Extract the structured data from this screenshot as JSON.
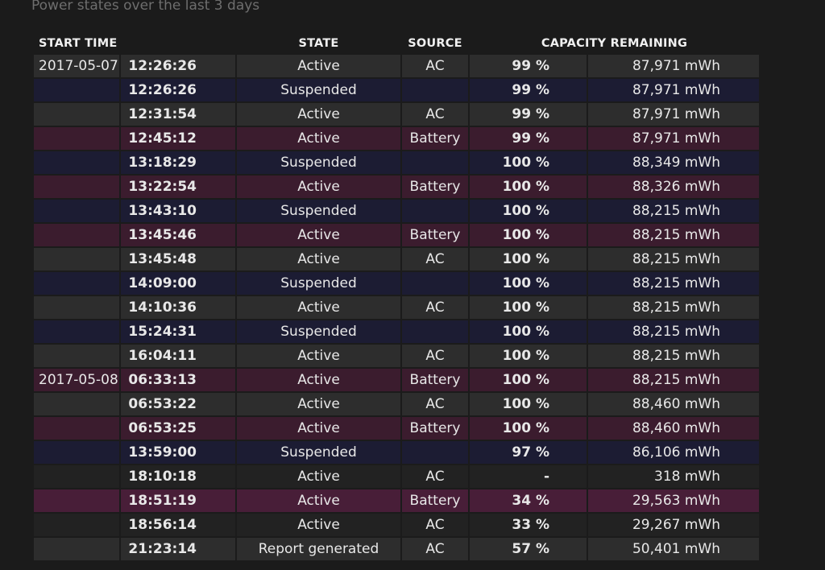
{
  "subtitle": "Power states over the last 3 days",
  "columns": {
    "start_time": "START TIME",
    "state": "STATE",
    "source": "SOURCE",
    "capacity": "CAPACITY REMAINING"
  },
  "rows": [
    {
      "date": "2017-05-07",
      "time": "12:26:26",
      "state": "Active",
      "source": "AC",
      "percent": "99 %",
      "capacity": "87,971 mWh",
      "tone": "ac"
    },
    {
      "date": "",
      "time": "12:26:26",
      "state": "Suspended",
      "source": "",
      "percent": "99 %",
      "capacity": "87,971 mWh",
      "tone": "suspended"
    },
    {
      "date": "",
      "time": "12:31:54",
      "state": "Active",
      "source": "AC",
      "percent": "99 %",
      "capacity": "87,971 mWh",
      "tone": "ac"
    },
    {
      "date": "",
      "time": "12:45:12",
      "state": "Active",
      "source": "Battery",
      "percent": "99 %",
      "capacity": "87,971 mWh",
      "tone": "battery"
    },
    {
      "date": "",
      "time": "13:18:29",
      "state": "Suspended",
      "source": "",
      "percent": "100 %",
      "capacity": "88,349 mWh",
      "tone": "suspended"
    },
    {
      "date": "",
      "time": "13:22:54",
      "state": "Active",
      "source": "Battery",
      "percent": "100 %",
      "capacity": "88,326 mWh",
      "tone": "battery"
    },
    {
      "date": "",
      "time": "13:43:10",
      "state": "Suspended",
      "source": "",
      "percent": "100 %",
      "capacity": "88,215 mWh",
      "tone": "suspended"
    },
    {
      "date": "",
      "time": "13:45:46",
      "state": "Active",
      "source": "Battery",
      "percent": "100 %",
      "capacity": "88,215 mWh",
      "tone": "battery"
    },
    {
      "date": "",
      "time": "13:45:48",
      "state": "Active",
      "source": "AC",
      "percent": "100 %",
      "capacity": "88,215 mWh",
      "tone": "ac"
    },
    {
      "date": "",
      "time": "14:09:00",
      "state": "Suspended",
      "source": "",
      "percent": "100 %",
      "capacity": "88,215 mWh",
      "tone": "suspended"
    },
    {
      "date": "",
      "time": "14:10:36",
      "state": "Active",
      "source": "AC",
      "percent": "100 %",
      "capacity": "88,215 mWh",
      "tone": "ac"
    },
    {
      "date": "",
      "time": "15:24:31",
      "state": "Suspended",
      "source": "",
      "percent": "100 %",
      "capacity": "88,215 mWh",
      "tone": "suspended"
    },
    {
      "date": "",
      "time": "16:04:11",
      "state": "Active",
      "source": "AC",
      "percent": "100 %",
      "capacity": "88,215 mWh",
      "tone": "ac"
    },
    {
      "date": "2017-05-08",
      "time": "06:33:13",
      "state": "Active",
      "source": "Battery",
      "percent": "100 %",
      "capacity": "88,215 mWh",
      "tone": "battery"
    },
    {
      "date": "",
      "time": "06:53:22",
      "state": "Active",
      "source": "AC",
      "percent": "100 %",
      "capacity": "88,460 mWh",
      "tone": "ac"
    },
    {
      "date": "",
      "time": "06:53:25",
      "state": "Active",
      "source": "Battery",
      "percent": "100 %",
      "capacity": "88,460 mWh",
      "tone": "battery"
    },
    {
      "date": "",
      "time": "13:59:00",
      "state": "Suspended",
      "source": "",
      "percent": "97 %",
      "capacity": "86,106 mWh",
      "tone": "suspended"
    },
    {
      "date": "",
      "time": "18:10:18",
      "state": "Active",
      "source": "AC",
      "percent": "-",
      "capacity": "318 mWh",
      "tone": "ac-dark"
    },
    {
      "date": "",
      "time": "18:51:19",
      "state": "Active",
      "source": "Battery",
      "percent": "34 %",
      "capacity": "29,563 mWh",
      "tone": "battery-strong"
    },
    {
      "date": "",
      "time": "18:56:14",
      "state": "Active",
      "source": "AC",
      "percent": "33 %",
      "capacity": "29,267 mWh",
      "tone": "ac-dark"
    },
    {
      "date": "",
      "time": "21:23:14",
      "state": "Report generated",
      "source": "AC",
      "percent": "57 %",
      "capacity": "50,401 mWh",
      "tone": "ac"
    }
  ],
  "colors": {
    "background": "#1b1b1b",
    "ac_row": "#2d2d2d",
    "suspended_row": "#1c1c33",
    "battery_row": "#3b1c2e"
  }
}
